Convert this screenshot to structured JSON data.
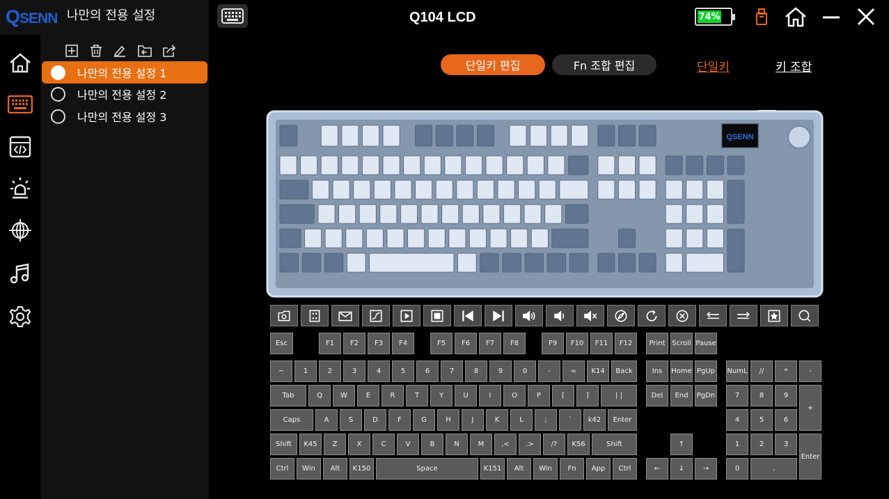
{
  "app": {
    "logo": "SENN",
    "logo_q": "Q",
    "title": "나만의 전용 설정",
    "device_name": "Q104 LCD",
    "battery": "74%",
    "battery_level": 0.74
  },
  "window": {
    "buttons": [
      "usb-icon",
      "home-icon",
      "minimize-icon",
      "close-icon"
    ]
  },
  "sidebar": {
    "items": [
      "home-icon",
      "keyboard-icon",
      "macro-icon",
      "lighting-icon",
      "network-icon",
      "music-icon",
      "settings-icon"
    ]
  },
  "profiles": {
    "toolbar": [
      "add-icon",
      "delete-icon",
      "rename-icon",
      "import-icon",
      "export-icon"
    ],
    "items": [
      {
        "label": "나만의 전용 설정 1",
        "active": true
      },
      {
        "label": "나만의 전용 설정 2",
        "active": false
      },
      {
        "label": "나만의 전용 설정 3",
        "active": false
      }
    ]
  },
  "edit_tabs": {
    "single": "단일키 편집",
    "fn": "Fn 조합 편집"
  },
  "mode_links": {
    "single": "단일키",
    "combo": "키 조합"
  },
  "accent_color": "#e8661b",
  "keyboard_preview": {
    "brand": "QSENN"
  },
  "media_buttons": [
    "folder-camera-icon",
    "calculator-icon",
    "mail-icon",
    "chart-icon",
    "play-icon",
    "stop-icon",
    "previous-track-icon",
    "next-track-icon",
    "volume-up-icon",
    "volume-down-icon",
    "mute-icon",
    "compass-icon",
    "refresh-icon",
    "stop-circle-icon",
    "back-arrow-icon",
    "forward-arrow-icon",
    "favorite-icon",
    "search-icon"
  ],
  "keys": {
    "esc": "Esc",
    "f1": "F1",
    "f2": "F2",
    "f3": "F3",
    "f4": "F4",
    "f5": "F5",
    "f6": "F6",
    "f7": "F7",
    "f8": "F8",
    "f9": "F9",
    "f10": "F10",
    "f11": "F11",
    "f12": "F12",
    "print": "Print",
    "scroll": "Scroll",
    "pause": "Pause",
    "tilde": "~",
    "n1": "1",
    "n2": "2",
    "n3": "3",
    "n4": "4",
    "n5": "5",
    "n6": "6",
    "n7": "7",
    "n8": "8",
    "n9": "9",
    "n0": "0",
    "minus": "-",
    "equal": "=",
    "k14": "K14",
    "back": "Back",
    "ins": "Ins",
    "home": "Home",
    "pgup": "PgUp",
    "numl": "NumL",
    "kpslash": "//",
    "kpstar": "*",
    "kpminus": "-",
    "tab": "Tab",
    "q": "Q",
    "w": "W",
    "e": "E",
    "r": "R",
    "t": "T",
    "y": "Y",
    "u": "U",
    "i": "I",
    "o": "O",
    "p": "P",
    "lbr": "[",
    "rbr": "]",
    "pipe": "| |",
    "del": "Del",
    "end": "End",
    "pgdn": "PgDn",
    "kp7": "7",
    "kp8": "8",
    "kp9": "9",
    "kpplus": "+",
    "caps": "Caps",
    "a": "A",
    "s": "S",
    "d": "D",
    "f": "F",
    "g": "G",
    "h": "H",
    "j": "J",
    "k": "K",
    "l": "L",
    "semi": ";",
    "quote": "`",
    "k42": "k42",
    "enter": "Enter",
    "kp4": "4",
    "kp5": "5",
    "kp6": "6",
    "lshift": "Shift",
    "k45": "K45",
    "z": "Z",
    "x": "X",
    "c": "C",
    "v": "V",
    "b": "B",
    "n": "N",
    "m": "M",
    "comma": ",<",
    "period": ".>",
    "slash": "/?",
    "k56": "K56",
    "rshift": "Shift",
    "up": "↑",
    "kp1": "1",
    "kp2": "2",
    "kp3": "3",
    "kpenter": "Enter",
    "lctrl": "Ctrl",
    "lwin": "Win",
    "lalt": "Alt",
    "k150": "K150",
    "space": "Space",
    "k151": "K151",
    "ralt": "Alt",
    "rwin": "Win",
    "fn": "Fn",
    "app": "App",
    "rctrl": "Ctrl",
    "left": "←",
    "down": "↓",
    "right": "→",
    "kp0": "0",
    "kpdot": "."
  }
}
